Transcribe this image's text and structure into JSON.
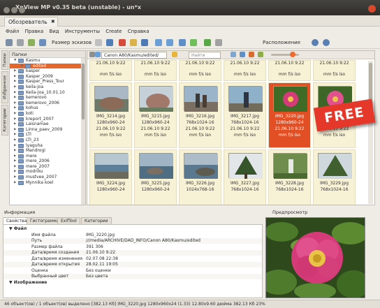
{
  "window": {
    "title": "XnView MP v0.35 beta (unstable) - un*x"
  },
  "tab": {
    "label": "Обозреватель"
  },
  "menu": [
    "Файл",
    "Правка",
    "Вид",
    "Инструменты",
    "Create",
    "Справка"
  ],
  "toolbar": {
    "thumb_size_label": "Размер эскизов",
    "layout_label": "Расположение"
  },
  "sidebar_tabs": [
    "Папки",
    "Избранное",
    "Категории"
  ],
  "folders": {
    "header": "Папки",
    "items": [
      {
        "label": "Kasmu",
        "level": 2,
        "expanded": true
      },
      {
        "label": "edited",
        "level": 3,
        "selected": true
      },
      {
        "label": "kasper",
        "level": 2
      },
      {
        "label": "Kasper_2009",
        "level": 2
      },
      {
        "label": "Kasper_Press_Tour",
        "level": 2
      },
      {
        "label": "keila-joa",
        "level": 2
      },
      {
        "label": "Keila-Joa_10.01.10",
        "level": 2
      },
      {
        "label": "kemerovo",
        "level": 2
      },
      {
        "label": "kemerovo_2006",
        "level": 2
      },
      {
        "label": "kohus",
        "level": 2
      },
      {
        "label": "koti",
        "level": 2
      },
      {
        "label": "kreport_2007",
        "level": 2
      },
      {
        "label": "Laisnamae",
        "level": 2
      },
      {
        "label": "Linna_paev_2009",
        "level": 2
      },
      {
        "label": "LTI",
        "level": 2
      },
      {
        "label": "LTI_23",
        "level": 2
      },
      {
        "label": "lyaguha",
        "level": 2
      },
      {
        "label": "Mandrogi",
        "level": 2
      },
      {
        "label": "mere",
        "level": 2
      },
      {
        "label": "mere_2006",
        "level": 2
      },
      {
        "label": "mere_2007",
        "level": 2
      },
      {
        "label": "modriku",
        "level": 2
      },
      {
        "label": "mustvee_2007",
        "level": 2
      },
      {
        "label": "Mynnika koel",
        "level": 2
      }
    ]
  },
  "browser": {
    "path": "Canon A80/Kasmu/edited/",
    "search_placeholder": "Найти",
    "rows": [
      {
        "type": "info",
        "cells": [
          [
            "21.06.10 9:22",
            "",
            "mm f/s iso"
          ],
          [
            "21.06.10 9:22",
            "",
            "mm f/s iso"
          ],
          [
            "21.06.10 9:22",
            "",
            "mm f/s iso"
          ],
          [
            "21.06.10 9:22",
            "",
            "mm f/s iso"
          ],
          [
            "21.06.10 9:22",
            "",
            "mm f/s iso"
          ],
          [
            "21.06.10 9:22",
            "",
            "mm f/s iso"
          ]
        ]
      },
      {
        "type": "thumbs",
        "items": [
          {
            "name": "IMG_3214.jpg",
            "dims": "1280x960-24",
            "date": "21.06.10 9:22",
            "exif": "mm f/s iso",
            "scene": "rocks1"
          },
          {
            "name": "IMG_3215.jpg",
            "dims": "1280x960-24",
            "date": "21.06.10 9:22",
            "exif": "mm f/s iso",
            "scene": "rock"
          },
          {
            "name": "IMG_3216.jpg",
            "dims": "768x1024-16",
            "date": "21.06.10 9:22",
            "exif": "mm f/s iso",
            "scene": "people"
          },
          {
            "name": "IMG_3217.jpg",
            "dims": "768x1024-16",
            "date": "21.06.10 9:22",
            "exif": "mm f/s iso",
            "scene": "person"
          },
          {
            "name": "IMG_3220.jpg",
            "dims": "1280x960-24",
            "date": "21.06.10 9:22",
            "exif": "mm f/s iso",
            "scene": "flower",
            "selected": true
          },
          {
            "name": "IMG_3221.jpg",
            "dims": "768x1024-16",
            "date": "21.06.10 9:22",
            "exif": "mm f/s iso",
            "scene": "flower2"
          }
        ]
      },
      {
        "type": "thumbs",
        "items": [
          {
            "name": "IMG_3224.jpg",
            "dims": "1280x960-24",
            "date": "",
            "exif": "",
            "scene": "sea"
          },
          {
            "name": "IMG_3225.jpg",
            "dims": "1280x960-24",
            "date": "",
            "exif": "",
            "scene": "sea2"
          },
          {
            "name": "IMG_3226.jpg",
            "dims": "1024x768-16",
            "date": "",
            "exif": "",
            "scene": "sea3"
          },
          {
            "name": "IMG_3227.jpg",
            "dims": "768x1024-16",
            "date": "",
            "exif": "",
            "scene": "tree"
          },
          {
            "name": "IMG_3228.jpg",
            "dims": "768x1024-16",
            "date": "",
            "exif": "",
            "scene": "person2"
          },
          {
            "name": "IMG_3229.jpg",
            "dims": "768x1024-16",
            "date": "",
            "exif": "",
            "scene": "tree2"
          }
        ]
      }
    ]
  },
  "badge": {
    "label": "FREE",
    "color": "#e5372a"
  },
  "info": {
    "header": "Информация",
    "tabs": [
      "Свойства",
      "Гистограмма",
      "ExifTool",
      "Категории"
    ],
    "sections": [
      {
        "title": "Файл",
        "rows": [
          [
            "Имя файла",
            "IMG_3220.jpg"
          ],
          [
            "Путь",
            "///media/ARCHIVE/DAD_INFO/Canon A80/Kasmu/edited"
          ],
          [
            "Размер файла",
            "391 306"
          ],
          [
            "Дата/время создания",
            "21.06.10 9:22"
          ],
          [
            "Дата/время изменения",
            "02.07.08 22:38"
          ],
          [
            "Дата/время открытия",
            "28.02.11 19:05"
          ],
          [
            "Оценка",
            "Без оценки"
          ],
          [
            "Выбранный цвет",
            "Без цвета"
          ]
        ]
      },
      {
        "title": "Изображение",
        "rows": []
      }
    ]
  },
  "preview": {
    "header": "Предпросмотр"
  },
  "status": {
    "text": "46 объект(ов) / 1 объект(ов) выделено [382.13 Кб]   IMG_3220.jpg   1280x960x24 (1.33)   12.80x9.60 дюйма   382.13 Кб   23%"
  }
}
